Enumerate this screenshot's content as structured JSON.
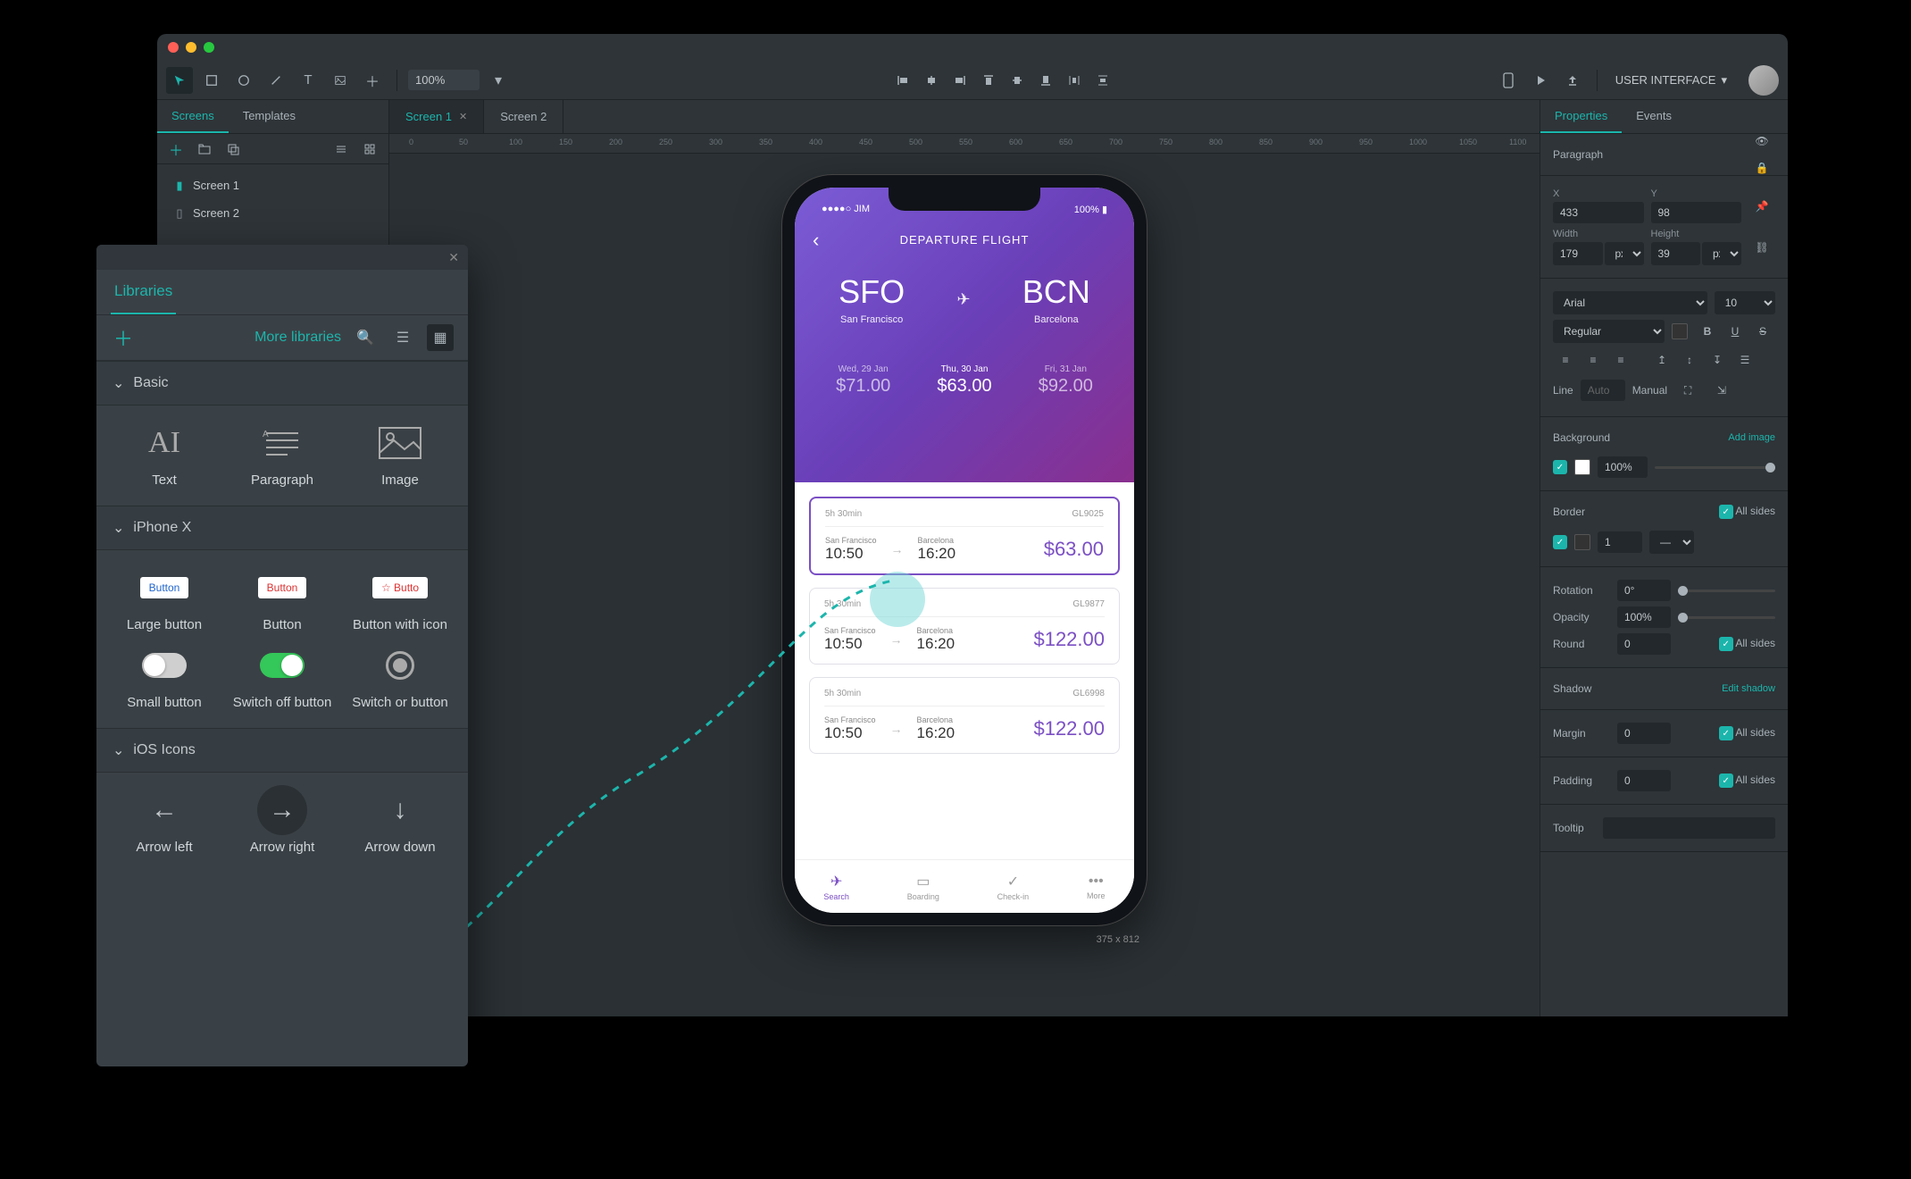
{
  "toolbar": {
    "zoom": "100%",
    "project_name": "USER INTERFACE"
  },
  "left": {
    "tabs": [
      "Screens",
      "Templates"
    ],
    "screens": [
      "Screen 1",
      "Screen 2"
    ]
  },
  "canvas": {
    "tabs": [
      {
        "label": "Screen 1",
        "active": true,
        "closeable": true
      },
      {
        "label": "Screen 2",
        "active": false,
        "closeable": false
      }
    ],
    "ruler_marks": [
      0,
      50,
      100,
      150,
      200,
      250,
      300,
      350,
      400,
      450,
      500,
      550,
      600,
      650,
      700,
      750,
      800,
      850,
      900,
      950,
      1000,
      1050,
      1100
    ],
    "frame_dim": "375 x 812"
  },
  "phone": {
    "carrier": "JIM",
    "battery": "100%",
    "title": "DEPARTURE FLIGHT",
    "from_code": "SFO",
    "from_city": "San Francisco",
    "to_code": "BCN",
    "to_city": "Barcelona",
    "dates": [
      {
        "label": "Wed, 29 Jan",
        "price": "$71.00"
      },
      {
        "label": "Thu, 30 Jan",
        "price": "$63.00"
      },
      {
        "label": "Fri, 31 Jan",
        "price": "$92.00"
      }
    ],
    "flights": [
      {
        "duration": "5h 30min",
        "code": "GL9025",
        "dep_city": "San Francisco",
        "dep_time": "10:50",
        "arr_city": "Barcelona",
        "arr_time": "16:20",
        "price": "$63.00",
        "selected": true
      },
      {
        "duration": "5h 30min",
        "code": "GL9877",
        "dep_city": "San Francisco",
        "dep_time": "10:50",
        "arr_city": "Barcelona",
        "arr_time": "16:20",
        "price": "$122.00",
        "selected": false
      },
      {
        "duration": "5h 30min",
        "code": "GL6998",
        "dep_city": "San Francisco",
        "dep_time": "10:50",
        "arr_city": "Barcelona",
        "arr_time": "16:20",
        "price": "$122.00",
        "selected": false
      }
    ],
    "tabbar": [
      "Search",
      "Boarding",
      "Check-in",
      "More"
    ]
  },
  "properties": {
    "tabs": [
      "Properties",
      "Events"
    ],
    "element": "Paragraph",
    "x_label": "X",
    "x": "433",
    "y_label": "Y",
    "y": "98",
    "w_label": "Width",
    "w": "179",
    "w_unit": "px",
    "h_label": "Height",
    "h": "39",
    "h_unit": "px",
    "font": "Arial",
    "font_size": "10",
    "font_weight": "Regular",
    "line_label": "Line",
    "line_auto": "Auto",
    "line_mode": "Manual",
    "bg_label": "Background",
    "bg_add": "Add image",
    "bg_opacity": "100%",
    "border_label": "Border",
    "all_sides": "All sides",
    "border_width": "1",
    "rotation_label": "Rotation",
    "rotation": "0°",
    "opacity_label": "Opacity",
    "opacity": "100%",
    "round_label": "Round",
    "round": "0",
    "shadow_label": "Shadow",
    "shadow_edit": "Edit shadow",
    "margin_label": "Margin",
    "margin": "0",
    "padding_label": "Padding",
    "padding": "0",
    "tooltip_label": "Tooltip"
  },
  "libraries": {
    "title": "Libraries",
    "more": "More libraries",
    "sections": {
      "basic": {
        "title": "Basic",
        "items": [
          "Text",
          "Paragraph",
          "Image"
        ]
      },
      "iphonex": {
        "title": "iPhone X",
        "items": [
          "Large button",
          "Button",
          "Button with icon",
          "Small button",
          "Switch off button",
          "Switch or button"
        ]
      },
      "ios_icons": {
        "title": "iOS Icons",
        "items": [
          "Arrow left",
          "Arrow right",
          "Arrow down"
        ]
      }
    }
  }
}
